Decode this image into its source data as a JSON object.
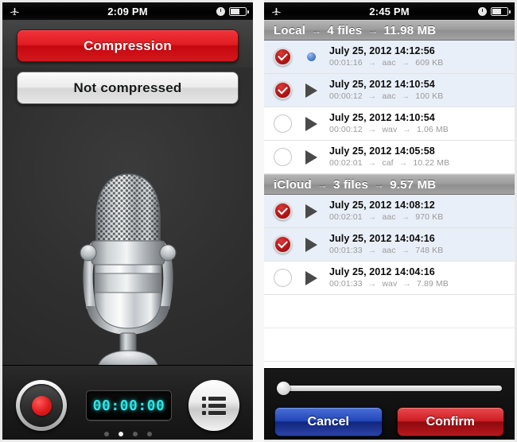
{
  "left_phone": {
    "status_bar": {
      "airplane_icon": "airplane-mode-icon",
      "time": "2:09 PM",
      "alarm_icon": "alarm-clock-icon",
      "battery_icon": "battery-icon"
    },
    "buttons": {
      "compression_label": "Compression",
      "not_compressed_label": "Not compressed"
    },
    "artwork": {
      "microphone_icon": "microphone-icon"
    },
    "toolbar": {
      "record_label": "record-button",
      "timer_value": "00:00:00",
      "list_label": "list-button",
      "page_dots": 4,
      "active_dot": 2
    },
    "colors": {
      "accent_red": "#e01c22",
      "timer_cyan": "#2ce5e5",
      "background": "#303030"
    }
  },
  "right_phone": {
    "status_bar": {
      "airplane_icon": "airplane-mode-icon",
      "time": "2:45 PM",
      "alarm_icon": "alarm-clock-icon",
      "battery_icon": "battery-icon"
    },
    "sections": [
      {
        "name": "Local",
        "file_count": "4 files",
        "size": "11.98 MB",
        "arrow": "→",
        "rows": [
          {
            "selected": true,
            "status_icon": "unplayed-dot-icon",
            "title": "July 25, 2012 14:12:56",
            "duration": "00:01:16",
            "format": "aac",
            "size": "609 KB"
          },
          {
            "selected": true,
            "status_icon": "play-icon",
            "title": "July 25, 2012 14:10:54",
            "duration": "00:00:12",
            "format": "aac",
            "size": "100 KB"
          },
          {
            "selected": false,
            "status_icon": "play-icon",
            "title": "July 25, 2012 14:10:54",
            "duration": "00:00:12",
            "format": "wav",
            "size": "1.06 MB"
          },
          {
            "selected": false,
            "status_icon": "play-icon",
            "title": "July 25, 2012 14:05:58",
            "duration": "00:02:01",
            "format": "caf",
            "size": "10.22 MB"
          }
        ]
      },
      {
        "name": "iCloud",
        "file_count": "3 files",
        "size": "9.57 MB",
        "arrow": "→",
        "rows": [
          {
            "selected": true,
            "status_icon": "play-icon",
            "title": "July 25, 2012 14:08:12",
            "duration": "00:02:01",
            "format": "aac",
            "size": "970 KB"
          },
          {
            "selected": true,
            "status_icon": "play-icon",
            "title": "July 25, 2012 14:04:16",
            "duration": "00:01:33",
            "format": "aac",
            "size": "748 KB"
          },
          {
            "selected": false,
            "status_icon": "play-icon",
            "title": "July 25, 2012 14:04:16",
            "duration": "00:01:33",
            "format": "wav",
            "size": "7.89 MB"
          }
        ]
      }
    ],
    "control_bar": {
      "slider_position_percent": 0,
      "cancel_label": "Cancel",
      "confirm_label": "Confirm"
    },
    "colors": {
      "cancel_blue": "#2348bb",
      "confirm_red": "#cf1f25",
      "selected_row": "#e9eff8",
      "check_red": "#b51616"
    }
  }
}
